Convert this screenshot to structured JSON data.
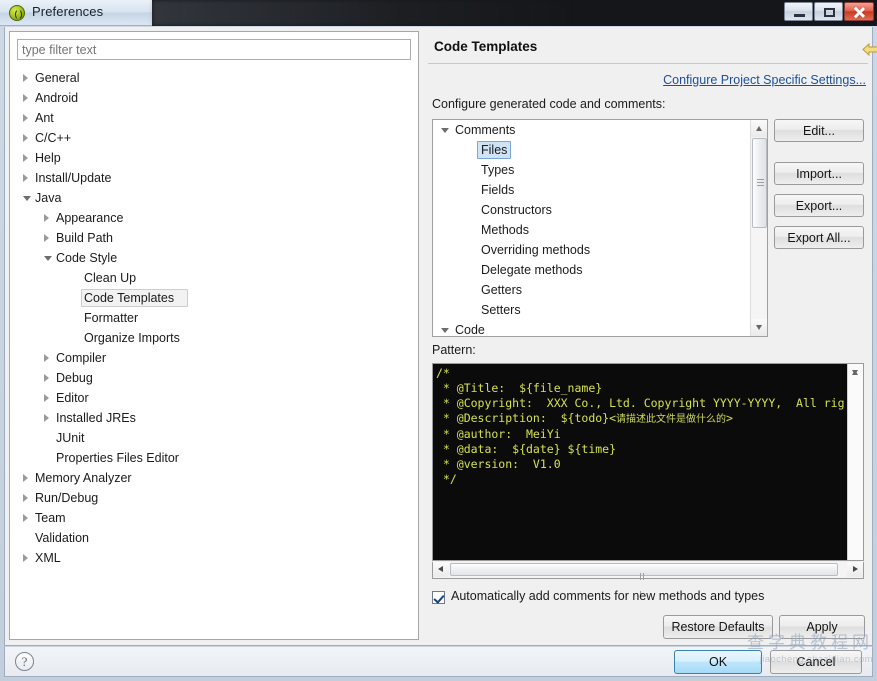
{
  "window": {
    "title": "Preferences",
    "icon": "eclipse-icon",
    "controls": {
      "minimize": "minimize-icon",
      "maximize": "maximize-icon",
      "close": "close-icon"
    }
  },
  "filter": {
    "placeholder": "type filter text",
    "value": ""
  },
  "tree": [
    {
      "label": "General",
      "indent": 0,
      "state": "collapsed"
    },
    {
      "label": "Android",
      "indent": 0,
      "state": "collapsed"
    },
    {
      "label": "Ant",
      "indent": 0,
      "state": "collapsed"
    },
    {
      "label": "C/C++",
      "indent": 0,
      "state": "collapsed"
    },
    {
      "label": "Help",
      "indent": 0,
      "state": "collapsed"
    },
    {
      "label": "Install/Update",
      "indent": 0,
      "state": "collapsed"
    },
    {
      "label": "Java",
      "indent": 0,
      "state": "expanded"
    },
    {
      "label": "Appearance",
      "indent": 1,
      "state": "collapsed"
    },
    {
      "label": "Build Path",
      "indent": 1,
      "state": "collapsed"
    },
    {
      "label": "Code Style",
      "indent": 1,
      "state": "expanded"
    },
    {
      "label": "Clean Up",
      "indent": 2,
      "state": "leaf"
    },
    {
      "label": "Code Templates",
      "indent": 2,
      "state": "leaf",
      "selected": true
    },
    {
      "label": "Formatter",
      "indent": 2,
      "state": "leaf"
    },
    {
      "label": "Organize Imports",
      "indent": 2,
      "state": "leaf"
    },
    {
      "label": "Compiler",
      "indent": 1,
      "state": "collapsed"
    },
    {
      "label": "Debug",
      "indent": 1,
      "state": "collapsed"
    },
    {
      "label": "Editor",
      "indent": 1,
      "state": "collapsed"
    },
    {
      "label": "Installed JREs",
      "indent": 1,
      "state": "collapsed"
    },
    {
      "label": "JUnit",
      "indent": 1,
      "state": "leaf"
    },
    {
      "label": "Properties Files Editor",
      "indent": 1,
      "state": "leaf"
    },
    {
      "label": "Memory Analyzer",
      "indent": 0,
      "state": "collapsed"
    },
    {
      "label": "Run/Debug",
      "indent": 0,
      "state": "collapsed"
    },
    {
      "label": "Team",
      "indent": 0,
      "state": "collapsed"
    },
    {
      "label": "Validation",
      "indent": 0,
      "state": "leaf"
    },
    {
      "label": "XML",
      "indent": 0,
      "state": "collapsed"
    }
  ],
  "page": {
    "title": "Code Templates",
    "project_settings_link": "Configure Project Specific Settings...",
    "caption": "Configure generated code and comments:",
    "nav": {
      "back": "back-arrow-icon",
      "back_menu": "back-dropdown-icon",
      "forward": "forward-arrow-icon",
      "forward_menu": "forward-dropdown-icon",
      "menu": "view-menu-icon"
    }
  },
  "templates": [
    {
      "label": "Comments",
      "indent": 0,
      "state": "expanded"
    },
    {
      "label": "Files",
      "indent": 1,
      "state": "leaf",
      "selected": true
    },
    {
      "label": "Types",
      "indent": 1,
      "state": "leaf"
    },
    {
      "label": "Fields",
      "indent": 1,
      "state": "leaf"
    },
    {
      "label": "Constructors",
      "indent": 1,
      "state": "leaf"
    },
    {
      "label": "Methods",
      "indent": 1,
      "state": "leaf"
    },
    {
      "label": "Overriding methods",
      "indent": 1,
      "state": "leaf"
    },
    {
      "label": "Delegate methods",
      "indent": 1,
      "state": "leaf"
    },
    {
      "label": "Getters",
      "indent": 1,
      "state": "leaf"
    },
    {
      "label": "Setters",
      "indent": 1,
      "state": "leaf"
    },
    {
      "label": "Code",
      "indent": 0,
      "state": "expanded"
    }
  ],
  "side_buttons": {
    "edit": "Edit...",
    "import": "Import...",
    "export": "Export...",
    "export_all": "Export All..."
  },
  "pattern": {
    "label": "Pattern:",
    "lines": [
      "/*",
      " * @Title:  ${file_name}",
      " * @Copyright:  XXX Co., Ltd. Copyright YYYY-YYYY,  All rig",
      " * @Description:  ${todo}<请描述此文件是做什么的>",
      " * @author:  MeiYi",
      " * @data:  ${date} ${time}",
      " * @version:  V1.0",
      " */"
    ]
  },
  "auto_comments": {
    "label": "Automatically add comments for new methods and types",
    "checked": true
  },
  "bottom_buttons": {
    "restore_defaults": "Restore Defaults",
    "apply": "Apply"
  },
  "footer": {
    "help": "?",
    "ok": "OK",
    "cancel": "Cancel"
  },
  "watermark": {
    "cn": "查字典教程网",
    "url": "jiaocheng.chazidian.com"
  },
  "colors": {
    "link": "#1b4f9c",
    "selection": "#cfe3f7",
    "code_fg": "#d6e24a",
    "code_bg": "#0b0b0b",
    "close_button": "#c93a22"
  }
}
